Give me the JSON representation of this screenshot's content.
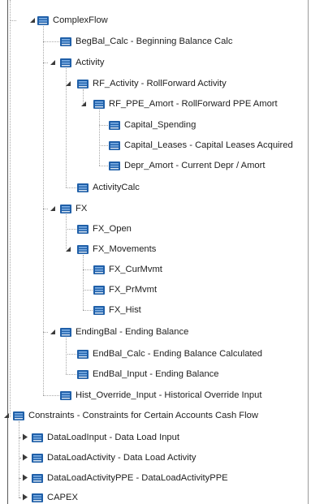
{
  "tree": {
    "nodes": [
      {
        "text": "ComplexFlow",
        "expander": "expanded"
      },
      {
        "text": "BegBal_Calc - Beginning Balance Calc",
        "expander": "none"
      },
      {
        "text": "Activity",
        "expander": "expanded"
      },
      {
        "text": "RF_Activity - RollForward Activity",
        "expander": "expanded"
      },
      {
        "text": "RF_PPE_Amort - RollForward PPE Amort",
        "expander": "expanded"
      },
      {
        "text": "Capital_Spending",
        "expander": "none"
      },
      {
        "text": "Capital_Leases - Capital Leases Acquired",
        "expander": "none"
      },
      {
        "text": "Depr_Amort - Current Depr / Amort",
        "expander": "none"
      },
      {
        "text": "ActivityCalc",
        "expander": "none"
      },
      {
        "text": "FX",
        "expander": "expanded"
      },
      {
        "text": "FX_Open",
        "expander": "none"
      },
      {
        "text": "FX_Movements",
        "expander": "expanded"
      },
      {
        "text": "FX_CurMvmt",
        "expander": "none"
      },
      {
        "text": "FX_PrMvmt",
        "expander": "none"
      },
      {
        "text": "FX_Hist",
        "expander": "none"
      },
      {
        "text": "EndingBal - Ending Balance",
        "expander": "expanded"
      },
      {
        "text": "EndBal_Calc - Ending Balance Calculated",
        "expander": "none"
      },
      {
        "text": "EndBal_Input - Ending Balance",
        "expander": "none"
      },
      {
        "text": "Hist_Override_Input - Historical Override Input",
        "expander": "none"
      },
      {
        "text": "Constraints - Constraints for Certain Accounts Cash Flow",
        "expander": "expanded"
      },
      {
        "text": "DataLoadInput - Data Load Input",
        "expander": "collapsed"
      },
      {
        "text": "DataLoadActivity - Data Load Activity",
        "expander": "collapsed"
      },
      {
        "text": "DataLoadActivityPPE - DataLoadActivityPPE",
        "expander": "collapsed"
      },
      {
        "text": "CAPEX",
        "expander": "collapsed"
      }
    ]
  },
  "colors": {
    "icon_fill": "#1f5fa8",
    "icon_stripe": "#7fb0e6",
    "expander": "#3a3a3a",
    "connector": "#a8a8a8"
  },
  "icons": {
    "member": "member-icon",
    "expanded": "triangle-down-icon",
    "collapsed": "triangle-right-icon"
  }
}
